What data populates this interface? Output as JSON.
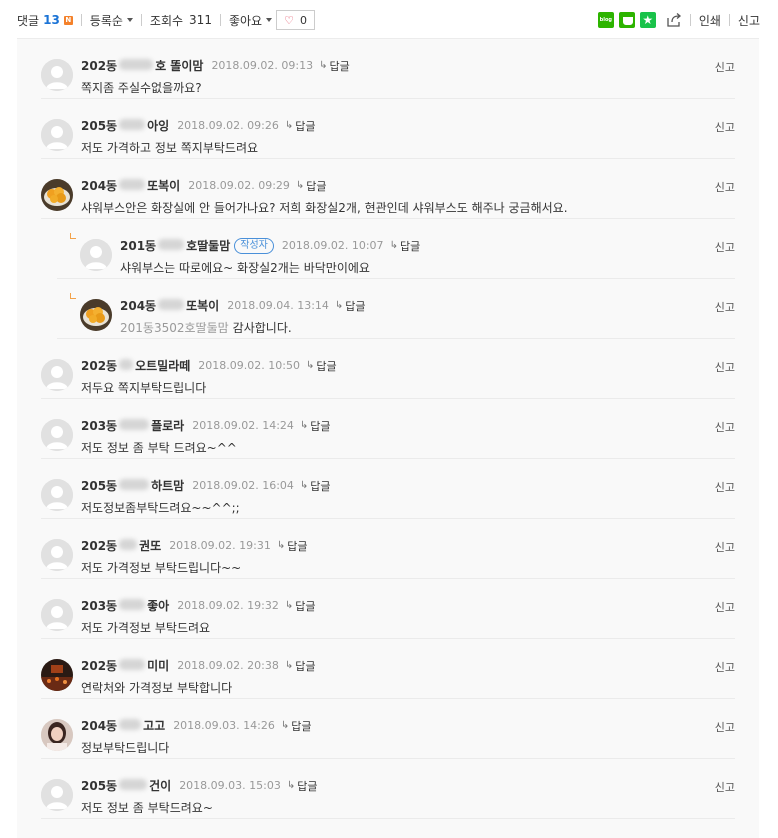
{
  "toolbar": {
    "comment_label": "댓글",
    "comment_count": "13",
    "new_badge": "N",
    "sort_label": "등록순",
    "views_label": "조회수",
    "views_count": "311",
    "like_label": "좋아요",
    "like_count": "0",
    "blog_icon_text": "blog",
    "print_label": "인쇄",
    "report_label": "신고"
  },
  "comments": [
    {
      "name_a": "202동",
      "name_b": "호 똘이맘",
      "date": "2018.09.02. 09:13",
      "reply": "답글",
      "text": "쪽지좀 주실수없을까요?",
      "report": "신고",
      "avatar": "default"
    },
    {
      "name_a": "205동",
      "name_b": "아잉",
      "date": "2018.09.02. 09:26",
      "reply": "답글",
      "text": "저도 가격하고 정보 쪽지부탁드려요",
      "report": "신고",
      "avatar": "default"
    },
    {
      "name_a": "204동",
      "name_b": "또복이",
      "date": "2018.09.02. 09:29",
      "reply": "답글",
      "text": "샤워부스안은 화장실에 안 들어가나요? 저희 화장실2개, 현관인데 샤워부스도 해주나 궁금해서요.",
      "report": "신고",
      "avatar": "food"
    },
    {
      "name_a": "201동",
      "name_b": "호딸둘맘",
      "writer_badge": "작성자",
      "date": "2018.09.02. 10:07",
      "reply": "답글",
      "text": "샤워부스는 따로에요~ 화장실2개는 바닥만이에요",
      "report": "신고",
      "avatar": "default"
    },
    {
      "name_a": "204동",
      "name_b": "또복이",
      "date": "2018.09.04. 13:14",
      "reply": "답글",
      "mention": "201동3502호딸둘맘",
      "text": "감사합니다.",
      "report": "신고",
      "avatar": "food"
    },
    {
      "name_a": "202동",
      "name_b": "오트밀라떼",
      "date": "2018.09.02. 10:50",
      "reply": "답글",
      "text": "저두요 쪽지부탁드립니다",
      "report": "신고",
      "avatar": "default"
    },
    {
      "name_a": "203동",
      "name_b": "플로라",
      "date": "2018.09.02. 14:24",
      "reply": "답글",
      "text": "저도 정보 좀 부탁 드려요~^^",
      "report": "신고",
      "avatar": "default"
    },
    {
      "name_a": "205동",
      "name_b": "하트맘",
      "date": "2018.09.02. 16:04",
      "reply": "답글",
      "text": "저도정보좀부탁드려요~~^^;;",
      "report": "신고",
      "avatar": "default"
    },
    {
      "name_a": "202동",
      "name_b": "권또",
      "date": "2018.09.02. 19:31",
      "reply": "답글",
      "text": "저도 가격정보 부탁드립니다~~",
      "report": "신고",
      "avatar": "default"
    },
    {
      "name_a": "203동",
      "name_b": "좋아",
      "date": "2018.09.02. 19:32",
      "reply": "답글",
      "text": "저도 가격정보 부탁드려요",
      "report": "신고",
      "avatar": "default"
    },
    {
      "name_a": "202동",
      "name_b": "미미",
      "date": "2018.09.02. 20:38",
      "reply": "답글",
      "text": "연락처와 가격정보 부탁합니다",
      "report": "신고",
      "avatar": "concert"
    },
    {
      "name_a": "204동",
      "name_b": "고고",
      "date": "2018.09.03. 14:26",
      "reply": "답글",
      "text": "정보부탁드립니다",
      "report": "신고",
      "avatar": "person"
    },
    {
      "name_a": "205동",
      "name_b": "건이",
      "date": "2018.09.03. 15:03",
      "reply": "답글",
      "text": "저도 정보 좀 부탁드려요~",
      "report": "신고",
      "avatar": "default"
    }
  ]
}
